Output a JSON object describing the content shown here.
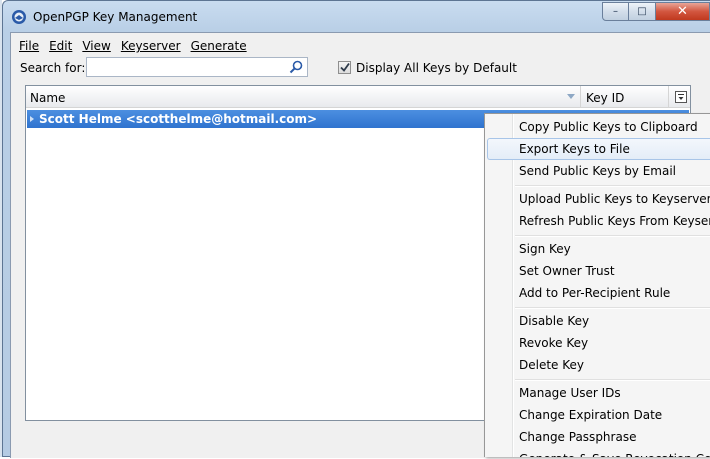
{
  "window": {
    "title": "OpenPGP Key Management"
  },
  "caption_buttons": {
    "minimize": "–",
    "maximize": "□",
    "close": "✕"
  },
  "menubar": [
    {
      "label": "File"
    },
    {
      "label": "Edit"
    },
    {
      "label": "View"
    },
    {
      "label": "Keyserver"
    },
    {
      "label": "Generate"
    }
  ],
  "search": {
    "label": "Search for:",
    "value": "",
    "placeholder": ""
  },
  "display_all": {
    "label": "Display All Keys by Default",
    "checked": true
  },
  "list": {
    "columns": {
      "name": "Name",
      "key_id": "Key ID"
    },
    "rows": [
      {
        "name": "Scott Helme <scotthelme@hotmail.com>",
        "key_id": ""
      }
    ]
  },
  "context_menu": {
    "groups": [
      [
        "Copy Public Keys to Clipboard",
        "Export Keys to File",
        "Send Public Keys by Email"
      ],
      [
        "Upload Public Keys to Keyserver",
        "Refresh Public Keys From Keyserver"
      ],
      [
        "Sign Key",
        "Set Owner Trust",
        "Add to Per-Recipient Rule"
      ],
      [
        "Disable Key",
        "Revoke Key",
        "Delete Key"
      ],
      [
        "Manage User IDs",
        "Change Expiration Date",
        "Change Passphrase",
        "Generate & Save Revocation Certificate"
      ]
    ],
    "highlighted": "Export Keys to File"
  },
  "colors": {
    "selection": "#3a7fd8",
    "menu_hover_border": "#a8c5e8",
    "close_button": "#c9452c"
  }
}
